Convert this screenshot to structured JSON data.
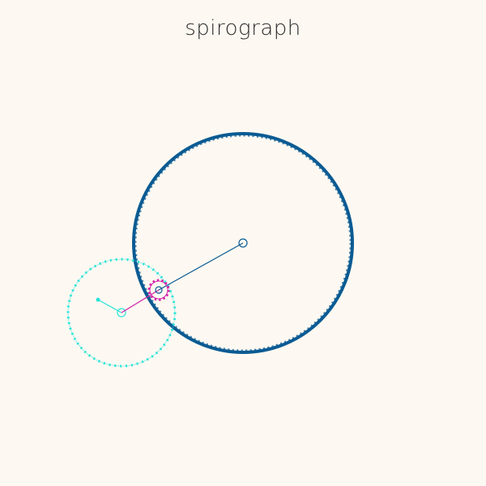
{
  "title": "spirograph",
  "colors": {
    "background": "#fdf9f2",
    "outer_gear": "#0b5b93",
    "small_gear": "#d21fa8",
    "cyan_gear": "#29e3d8",
    "title_text": "#2c2c2c"
  },
  "gears": {
    "outer": {
      "name": "outer-ring-gear",
      "teeth": 150
    },
    "small": {
      "name": "small-gear",
      "teeth": 14
    },
    "cyan": {
      "name": "cyan-gear",
      "teeth": 60
    }
  }
}
